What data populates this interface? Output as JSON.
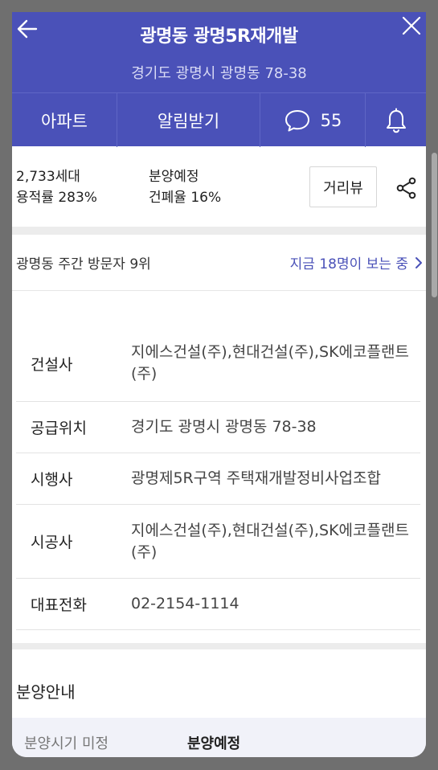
{
  "header": {
    "title": "광명동 광명5R재개발",
    "address": "경기도 광명시 광명동 78-38",
    "tabs": {
      "apartment": "아파트",
      "alarm": "알림받기",
      "comment_count": "55"
    }
  },
  "summary": {
    "households": "2,733세대",
    "floor_area_ratio": "용적률 283%",
    "status": "분양예정",
    "building_coverage": "건폐율 16%",
    "distance_view": "거리뷰"
  },
  "visitors": {
    "rank": "광명동 주간 방문자 9위",
    "now": "지금 18명이 보는 중"
  },
  "info": [
    {
      "key": "건설사",
      "value": "지에스건설(주),현대건설(주),SK에코플랜트(주)"
    },
    {
      "key": "공급위치",
      "value": "경기도 광명시 광명동 78-38"
    },
    {
      "key": "시행사",
      "value": "광명제5R구역 주택재개발정비사업조합"
    },
    {
      "key": "시공사",
      "value": "지에스건설(주),현대건설(주),SK에코플랜트(주)"
    },
    {
      "key": "대표전화",
      "value": "02-2154-1114"
    }
  ],
  "sale": {
    "title": "분양안내",
    "timing": "분양시기 미정",
    "status": "분양예정"
  },
  "colors": {
    "header": "#4a51b8",
    "accent": "#4a51b8",
    "overlay": "#6f6f6f"
  },
  "icons": [
    "arrow-left-icon",
    "close-icon",
    "comment-icon",
    "bell-icon",
    "share-icon",
    "chevron-right-icon"
  ]
}
